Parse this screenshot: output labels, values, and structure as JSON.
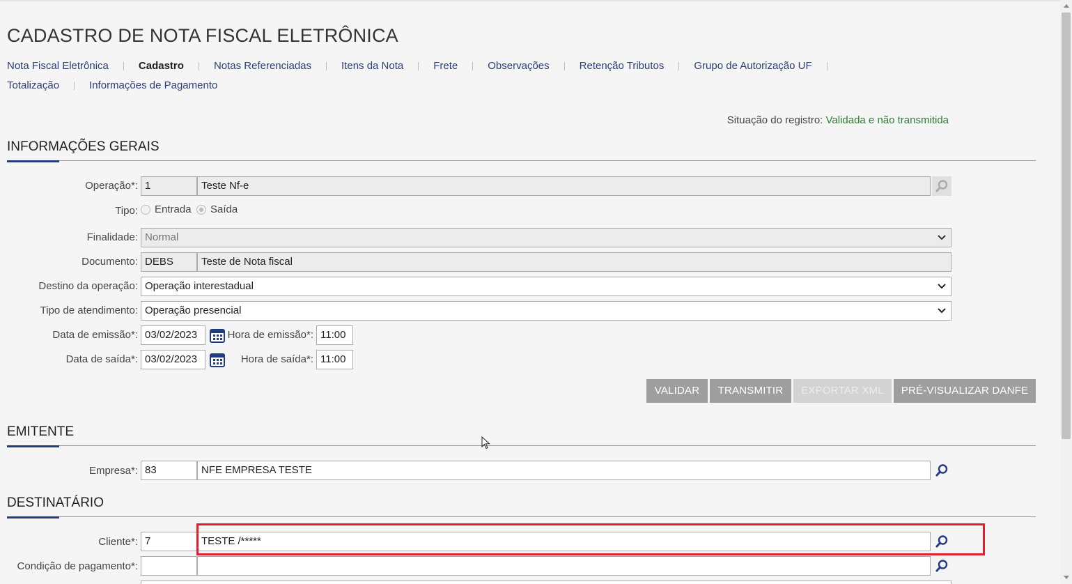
{
  "page_title": "CADASTRO DE NOTA FISCAL ELETRÔNICA",
  "tabs": [
    {
      "label": "Nota Fiscal Eletrônica"
    },
    {
      "label": "Cadastro"
    },
    {
      "label": "Notas Referenciadas"
    },
    {
      "label": "Itens da Nota"
    },
    {
      "label": "Frete"
    },
    {
      "label": "Observações"
    },
    {
      "label": "Retenção Tributos"
    },
    {
      "label": "Grupo de Autorização UF"
    },
    {
      "label": "Totalização"
    },
    {
      "label": "Informações de Pagamento"
    }
  ],
  "status": {
    "label": "Situação do registro:",
    "value": "Validada e não transmitida"
  },
  "sections": {
    "geral": "INFORMAÇÕES GERAIS",
    "emitente": "EMITENTE",
    "destinatario": "DESTINATÁRIO"
  },
  "form": {
    "operacao": {
      "label": "Operação*:",
      "code": "1",
      "desc": "Teste Nf-e"
    },
    "tipo": {
      "label": "Tipo:",
      "options": [
        "Entrada",
        "Saída"
      ],
      "selected": "Saída"
    },
    "finalidade": {
      "label": "Finalidade:",
      "value": "Normal"
    },
    "documento": {
      "label": "Documento:",
      "code": "DEBS",
      "desc": "Teste de Nota fiscal"
    },
    "destino": {
      "label": "Destino da operação:",
      "value": "Operação interestadual"
    },
    "atendimento": {
      "label": "Tipo de atendimento:",
      "value": "Operação presencial"
    },
    "data_emissao": {
      "label": "Data de emissão*:",
      "value": "03/02/2023"
    },
    "hora_emissao": {
      "label": "Hora de emissão*:",
      "value": "11:00"
    },
    "data_saida": {
      "label": "Data de saída*:",
      "value": "03/02/2023"
    },
    "hora_saida": {
      "label": "Hora de saída*:",
      "value": "11:00"
    },
    "empresa": {
      "label": "Empresa*:",
      "code": "83",
      "desc": "NFE EMPRESA TESTE"
    },
    "cliente": {
      "label": "Cliente*:",
      "code": "7",
      "desc": "TESTE /*****"
    },
    "condicao": {
      "label": "Condição de pagamento*:",
      "code": "",
      "desc": ""
    }
  },
  "buttons": {
    "validar": "VALIDAR",
    "transmitir": "TRANSMITIR",
    "exportar": "EXPORTAR XML",
    "previsualizar": "PRÉ-VISUALIZAR DANFE"
  },
  "colors": {
    "accent": "#233a85",
    "status_ok": "#2e7d32",
    "highlight": "#e01f2b",
    "button": "#9e9e9e"
  },
  "icons": [
    "search-icon",
    "calendar-icon",
    "chevron-down-icon"
  ]
}
